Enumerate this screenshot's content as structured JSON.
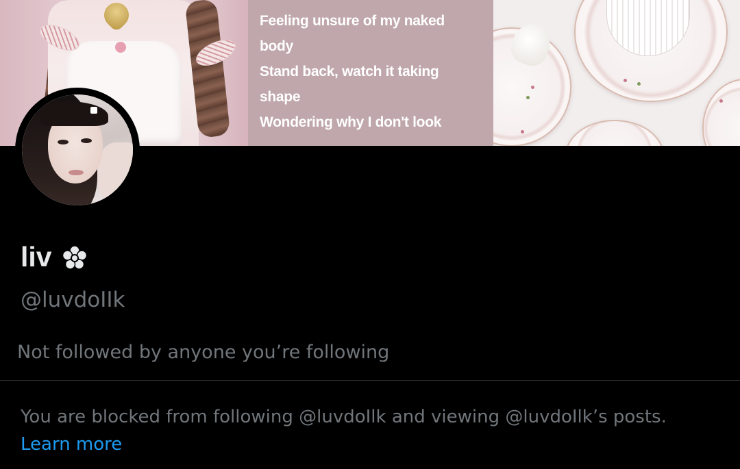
{
  "banner": {
    "lyrics_lines": [
      "Feeling unsure of my naked",
      "body",
      "Stand back, watch it taking",
      "shape",
      "Wondering why I don't look"
    ]
  },
  "profile": {
    "display_name": "liv",
    "name_emoji_icon": "white-flower-icon",
    "handle": "@luvdoIIk",
    "followed_by_text": "Not followed by anyone you’re following"
  },
  "blocked": {
    "message": "You are blocked from following @luvdoIlk and viewing @luvdoIlk’s posts.",
    "learn_more_label": "Learn more"
  },
  "colors": {
    "background": "#000000",
    "primary_text": "#e7e9ea",
    "secondary_text": "#71767b",
    "link": "#1d9bf0",
    "divider": "#2f3336"
  }
}
